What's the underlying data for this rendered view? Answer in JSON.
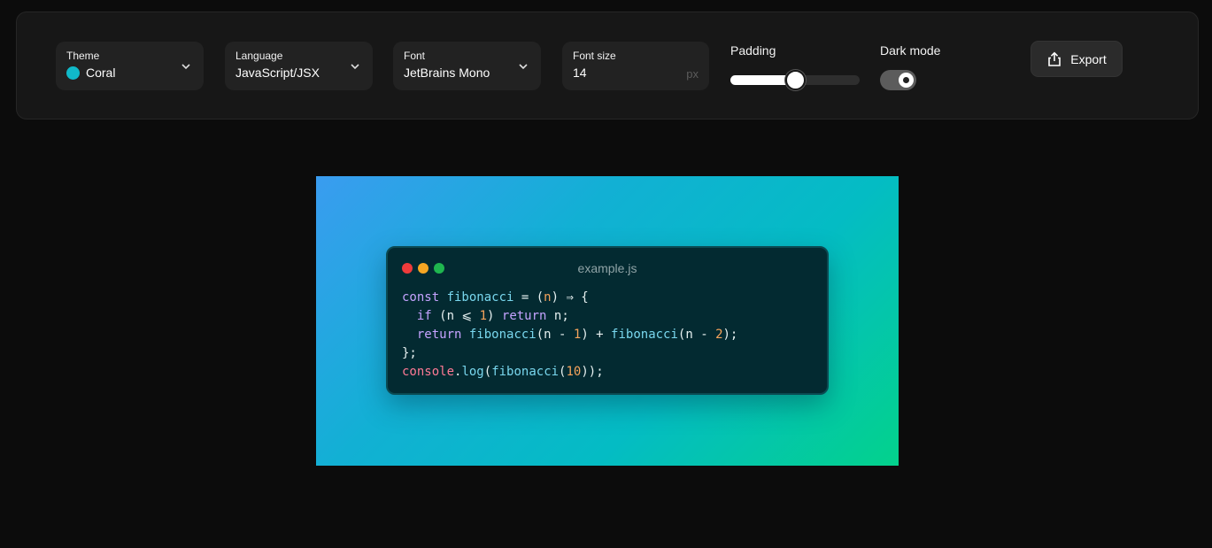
{
  "toolbar": {
    "theme": {
      "label": "Theme",
      "value": "Coral",
      "swatch_color": "#10b9c9"
    },
    "language": {
      "label": "Language",
      "value": "JavaScript/JSX"
    },
    "font": {
      "label": "Font",
      "value": "JetBrains Mono"
    },
    "font_size": {
      "label": "Font size",
      "value": "14",
      "unit": "px"
    },
    "padding": {
      "label": "Padding",
      "level": 0.5
    },
    "dark_mode": {
      "label": "Dark mode",
      "on": true
    },
    "export_label": "Export"
  },
  "preview": {
    "filename": "example.js",
    "background_colors": [
      "#3a9cf0",
      "#04bcc4",
      "#03d28c"
    ],
    "code_lines": [
      [
        {
          "t": "const ",
          "c": "kw"
        },
        {
          "t": "fibonacci",
          "c": "fn"
        },
        {
          "t": " = (",
          "c": "pl"
        },
        {
          "t": "n",
          "c": "num"
        },
        {
          "t": ") ⇒ {",
          "c": "pl"
        }
      ],
      [
        {
          "t": "  ",
          "c": "pl"
        },
        {
          "t": "if",
          "c": "kw"
        },
        {
          "t": " (n ⩽ ",
          "c": "pl"
        },
        {
          "t": "1",
          "c": "num"
        },
        {
          "t": ") ",
          "c": "pl"
        },
        {
          "t": "return",
          "c": "kw"
        },
        {
          "t": " n;",
          "c": "pl"
        }
      ],
      [
        {
          "t": "  ",
          "c": "pl"
        },
        {
          "t": "return",
          "c": "kw"
        },
        {
          "t": " ",
          "c": "pl"
        },
        {
          "t": "fibonacci",
          "c": "fn"
        },
        {
          "t": "(n - ",
          "c": "pl"
        },
        {
          "t": "1",
          "c": "num"
        },
        {
          "t": ") + ",
          "c": "pl"
        },
        {
          "t": "fibonacci",
          "c": "fn"
        },
        {
          "t": "(n - ",
          "c": "pl"
        },
        {
          "t": "2",
          "c": "num"
        },
        {
          "t": ");",
          "c": "pl"
        }
      ],
      [
        {
          "t": "};",
          "c": "pl"
        }
      ],
      [
        {
          "t": "console",
          "c": "obj"
        },
        {
          "t": ".",
          "c": "pl"
        },
        {
          "t": "log",
          "c": "fn"
        },
        {
          "t": "(",
          "c": "pl"
        },
        {
          "t": "fibonacci",
          "c": "fn"
        },
        {
          "t": "(",
          "c": "pl"
        },
        {
          "t": "10",
          "c": "num"
        },
        {
          "t": "));",
          "c": "pl"
        }
      ]
    ]
  }
}
